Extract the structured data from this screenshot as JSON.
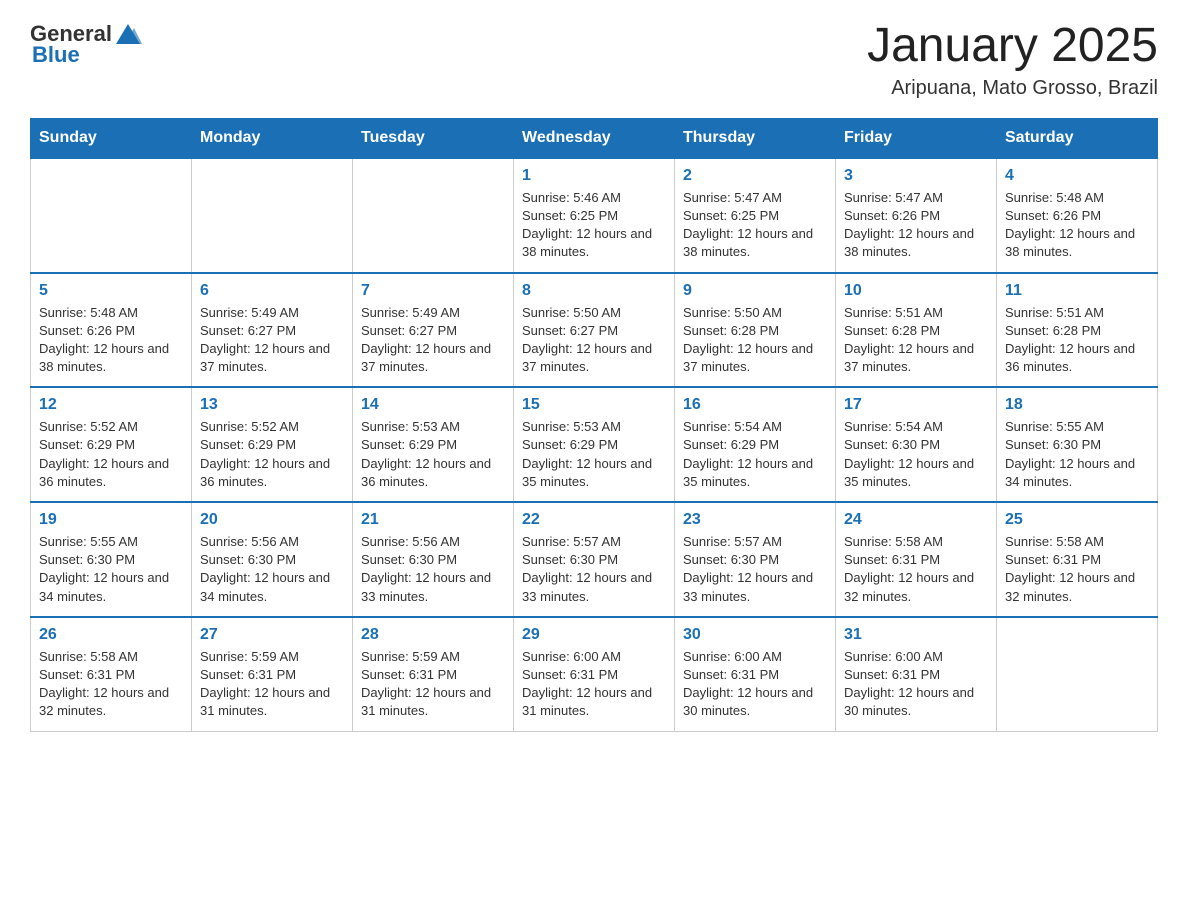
{
  "header": {
    "logo_general": "General",
    "logo_blue": "Blue",
    "month_year": "January 2025",
    "location": "Aripuana, Mato Grosso, Brazil"
  },
  "weekdays": [
    "Sunday",
    "Monday",
    "Tuesday",
    "Wednesday",
    "Thursday",
    "Friday",
    "Saturday"
  ],
  "weeks": [
    [
      {
        "day": "",
        "info": ""
      },
      {
        "day": "",
        "info": ""
      },
      {
        "day": "",
        "info": ""
      },
      {
        "day": "1",
        "info": "Sunrise: 5:46 AM\nSunset: 6:25 PM\nDaylight: 12 hours and 38 minutes."
      },
      {
        "day": "2",
        "info": "Sunrise: 5:47 AM\nSunset: 6:25 PM\nDaylight: 12 hours and 38 minutes."
      },
      {
        "day": "3",
        "info": "Sunrise: 5:47 AM\nSunset: 6:26 PM\nDaylight: 12 hours and 38 minutes."
      },
      {
        "day": "4",
        "info": "Sunrise: 5:48 AM\nSunset: 6:26 PM\nDaylight: 12 hours and 38 minutes."
      }
    ],
    [
      {
        "day": "5",
        "info": "Sunrise: 5:48 AM\nSunset: 6:26 PM\nDaylight: 12 hours and 38 minutes."
      },
      {
        "day": "6",
        "info": "Sunrise: 5:49 AM\nSunset: 6:27 PM\nDaylight: 12 hours and 37 minutes."
      },
      {
        "day": "7",
        "info": "Sunrise: 5:49 AM\nSunset: 6:27 PM\nDaylight: 12 hours and 37 minutes."
      },
      {
        "day": "8",
        "info": "Sunrise: 5:50 AM\nSunset: 6:27 PM\nDaylight: 12 hours and 37 minutes."
      },
      {
        "day": "9",
        "info": "Sunrise: 5:50 AM\nSunset: 6:28 PM\nDaylight: 12 hours and 37 minutes."
      },
      {
        "day": "10",
        "info": "Sunrise: 5:51 AM\nSunset: 6:28 PM\nDaylight: 12 hours and 37 minutes."
      },
      {
        "day": "11",
        "info": "Sunrise: 5:51 AM\nSunset: 6:28 PM\nDaylight: 12 hours and 36 minutes."
      }
    ],
    [
      {
        "day": "12",
        "info": "Sunrise: 5:52 AM\nSunset: 6:29 PM\nDaylight: 12 hours and 36 minutes."
      },
      {
        "day": "13",
        "info": "Sunrise: 5:52 AM\nSunset: 6:29 PM\nDaylight: 12 hours and 36 minutes."
      },
      {
        "day": "14",
        "info": "Sunrise: 5:53 AM\nSunset: 6:29 PM\nDaylight: 12 hours and 36 minutes."
      },
      {
        "day": "15",
        "info": "Sunrise: 5:53 AM\nSunset: 6:29 PM\nDaylight: 12 hours and 35 minutes."
      },
      {
        "day": "16",
        "info": "Sunrise: 5:54 AM\nSunset: 6:29 PM\nDaylight: 12 hours and 35 minutes."
      },
      {
        "day": "17",
        "info": "Sunrise: 5:54 AM\nSunset: 6:30 PM\nDaylight: 12 hours and 35 minutes."
      },
      {
        "day": "18",
        "info": "Sunrise: 5:55 AM\nSunset: 6:30 PM\nDaylight: 12 hours and 34 minutes."
      }
    ],
    [
      {
        "day": "19",
        "info": "Sunrise: 5:55 AM\nSunset: 6:30 PM\nDaylight: 12 hours and 34 minutes."
      },
      {
        "day": "20",
        "info": "Sunrise: 5:56 AM\nSunset: 6:30 PM\nDaylight: 12 hours and 34 minutes."
      },
      {
        "day": "21",
        "info": "Sunrise: 5:56 AM\nSunset: 6:30 PM\nDaylight: 12 hours and 33 minutes."
      },
      {
        "day": "22",
        "info": "Sunrise: 5:57 AM\nSunset: 6:30 PM\nDaylight: 12 hours and 33 minutes."
      },
      {
        "day": "23",
        "info": "Sunrise: 5:57 AM\nSunset: 6:30 PM\nDaylight: 12 hours and 33 minutes."
      },
      {
        "day": "24",
        "info": "Sunrise: 5:58 AM\nSunset: 6:31 PM\nDaylight: 12 hours and 32 minutes."
      },
      {
        "day": "25",
        "info": "Sunrise: 5:58 AM\nSunset: 6:31 PM\nDaylight: 12 hours and 32 minutes."
      }
    ],
    [
      {
        "day": "26",
        "info": "Sunrise: 5:58 AM\nSunset: 6:31 PM\nDaylight: 12 hours and 32 minutes."
      },
      {
        "day": "27",
        "info": "Sunrise: 5:59 AM\nSunset: 6:31 PM\nDaylight: 12 hours and 31 minutes."
      },
      {
        "day": "28",
        "info": "Sunrise: 5:59 AM\nSunset: 6:31 PM\nDaylight: 12 hours and 31 minutes."
      },
      {
        "day": "29",
        "info": "Sunrise: 6:00 AM\nSunset: 6:31 PM\nDaylight: 12 hours and 31 minutes."
      },
      {
        "day": "30",
        "info": "Sunrise: 6:00 AM\nSunset: 6:31 PM\nDaylight: 12 hours and 30 minutes."
      },
      {
        "day": "31",
        "info": "Sunrise: 6:00 AM\nSunset: 6:31 PM\nDaylight: 12 hours and 30 minutes."
      },
      {
        "day": "",
        "info": ""
      }
    ]
  ]
}
